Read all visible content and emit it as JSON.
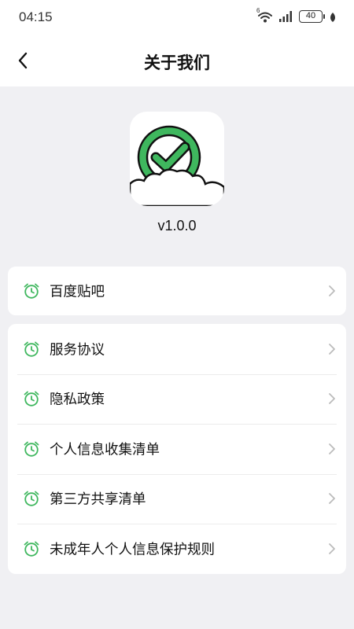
{
  "status_bar": {
    "time": "04:15",
    "battery": "40",
    "signal_badge": "6"
  },
  "nav": {
    "title": "关于我们",
    "back_icon": "chevron-left-icon"
  },
  "app": {
    "version": "v1.0.0",
    "icon": "check-circle-cloud-logo",
    "brand_color": "#3fb75e"
  },
  "groups": [
    {
      "items": [
        {
          "label": "百度贴吧",
          "icon": "alarm-clock-icon"
        }
      ]
    },
    {
      "items": [
        {
          "label": "服务协议",
          "icon": "alarm-clock-icon"
        },
        {
          "label": "隐私政策",
          "icon": "alarm-clock-icon"
        },
        {
          "label": "个人信息收集清单",
          "icon": "alarm-clock-icon"
        },
        {
          "label": "第三方共享清单",
          "icon": "alarm-clock-icon"
        },
        {
          "label": "未成年人个人信息保护规则",
          "icon": "alarm-clock-icon"
        }
      ]
    }
  ],
  "colors": {
    "accent": "#3fb75e",
    "background": "#f0f0f3",
    "card": "#ffffff",
    "chevron": "#bbbbbb"
  }
}
